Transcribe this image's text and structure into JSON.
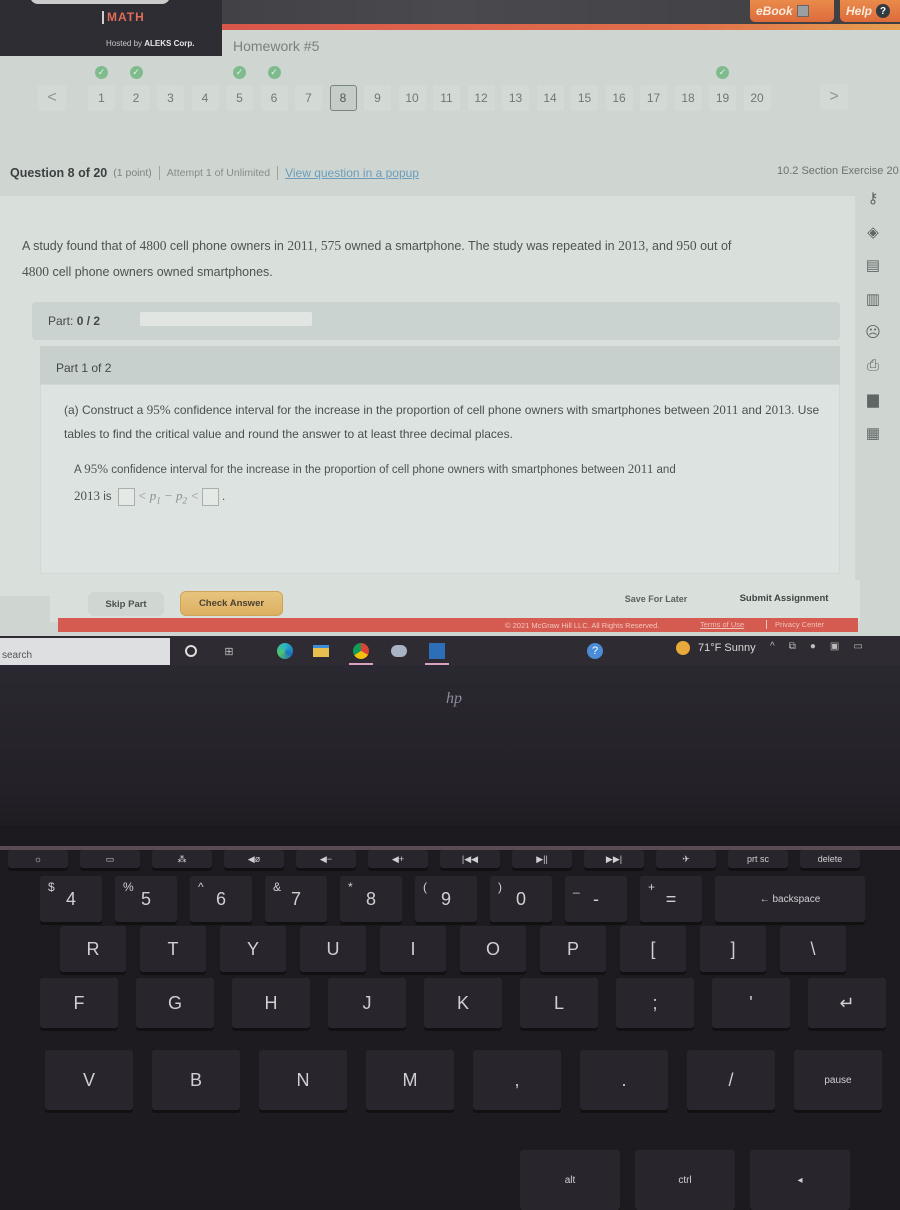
{
  "header": {
    "logo_product": "MATH",
    "logo_hosted_prefix": "Hosted by",
    "logo_hosted_name": "ALEKS Corp.",
    "assignment_title": "Homework #5",
    "ebook_label": "eBook",
    "help_label": "Help",
    "help_icon": "?"
  },
  "question_nav": {
    "prev_icon": "<",
    "next_icon": ">",
    "current": 8,
    "questions": [
      {
        "num": "1",
        "completed": true
      },
      {
        "num": "2",
        "completed": true
      },
      {
        "num": "3",
        "completed": false
      },
      {
        "num": "4",
        "completed": false
      },
      {
        "num": "5",
        "completed": true
      },
      {
        "num": "6",
        "completed": true
      },
      {
        "num": "7",
        "completed": false
      },
      {
        "num": "8",
        "completed": false
      },
      {
        "num": "9",
        "completed": false
      },
      {
        "num": "10",
        "completed": false
      },
      {
        "num": "11",
        "completed": false
      },
      {
        "num": "12",
        "completed": false
      },
      {
        "num": "13",
        "completed": false
      },
      {
        "num": "14",
        "completed": false
      },
      {
        "num": "15",
        "completed": false
      },
      {
        "num": "16",
        "completed": false
      },
      {
        "num": "17",
        "completed": false
      },
      {
        "num": "18",
        "completed": false
      },
      {
        "num": "19",
        "completed": true
      },
      {
        "num": "20",
        "completed": false
      }
    ],
    "check_icon": "✓"
  },
  "question_header": {
    "title": "Question 8 of 20",
    "points": "(1 point)",
    "attempt": "Attempt 1 of Unlimited",
    "popup_link": "View question in a popup",
    "section": "10.2 Section Exercise 20"
  },
  "problem": {
    "t1": "A study found that of ",
    "n1": "4800",
    "t2": " cell phone owners in ",
    "n2": "2011",
    "t3": ", ",
    "n3": "575",
    "t4": " owned a smartphone. The study was repeated in ",
    "n4": "2013",
    "t5": ", and ",
    "n5": "950",
    "t6": " out of ",
    "n6": "4800",
    "t7": " cell phone owners owned smartphones."
  },
  "part": {
    "label": "Part:",
    "progress": "0 / 2",
    "progress_fraction": 0,
    "current_label": "Part 1 of 2"
  },
  "instruction": {
    "t1": "(a) Construct a ",
    "n1": "95%",
    "t2": " confidence interval for the increase in the proportion of cell phone owners with smartphones between ",
    "n2": "2011",
    "t3": " and ",
    "n3": "2013",
    "t4": ". Use tables to find the critical value and round the answer to at least three decimal places."
  },
  "answer": {
    "t1": "A ",
    "n1": "95%",
    "t2": " confidence interval for the increase in the proportion of cell phone owners with smartphones between ",
    "n2": "2011",
    "t3": " and ",
    "n3": "2013",
    "t4": " is",
    "lower_value": "",
    "upper_value": "",
    "ineq_lt1": "<",
    "ineq_p1": "p",
    "ineq_sub1": "1",
    "ineq_minus": "−",
    "ineq_p2": "p",
    "ineq_sub2": "2",
    "ineq_lt2": "<",
    "period": "."
  },
  "tools": [
    {
      "name": "key-icon",
      "glyph": "⚷"
    },
    {
      "name": "tag-icon",
      "glyph": "◈"
    },
    {
      "name": "notes-icon",
      "glyph": "▤"
    },
    {
      "name": "ebook-icon",
      "glyph": "▥"
    },
    {
      "name": "ask-help-icon",
      "glyph": "☹"
    },
    {
      "name": "print-icon",
      "glyph": "⎙"
    },
    {
      "name": "chart-icon",
      "glyph": "▆"
    },
    {
      "name": "calculator-icon",
      "glyph": "▦"
    }
  ],
  "footer": {
    "skip_label": "Skip Part",
    "check_label": "Check Answer",
    "save_label": "Save For Later",
    "submit_label": "Submit Assignment",
    "copyright": "© 2021 McGraw Hill LLC. All Rights Reserved.",
    "terms": "Terms of Use",
    "privacy": "Privacy Center"
  },
  "taskbar": {
    "search_placeholder": "search",
    "task_view_glyph": "⊞",
    "help_glyph": "?",
    "weather": "71°F  Sunny",
    "tray_up": "^",
    "tray_items": [
      "⧉",
      "●",
      "▣",
      "▭"
    ]
  },
  "keyboard": {
    "brand": "hp",
    "fn_row": [
      "☼",
      "▭",
      "⁂",
      "◀ø",
      "◀−",
      "◀+",
      "|◀◀",
      "▶||",
      "▶▶|",
      "✈",
      "prt sc",
      "delete"
    ],
    "num_row": [
      {
        "main": "4",
        "sym": "$"
      },
      {
        "main": "5",
        "sym": "%"
      },
      {
        "main": "6",
        "sym": "^"
      },
      {
        "main": "7",
        "sym": "&"
      },
      {
        "main": "8",
        "sym": "*"
      },
      {
        "main": "9",
        "sym": "("
      },
      {
        "main": "0",
        "sym": ")"
      },
      {
        "main": "-",
        "sym": "_"
      },
      {
        "main": "=",
        "sym": "+"
      },
      {
        "main": "← backspace",
        "sym": ""
      }
    ],
    "top_row": [
      "R",
      "T",
      "Y",
      "U",
      "I",
      "O",
      "P",
      "[",
      "]",
      "\\"
    ],
    "home_row": [
      "F",
      "G",
      "H",
      "J",
      "K",
      "L",
      ";",
      "'",
      "↵"
    ],
    "bottom_row": [
      "V",
      "B",
      "N",
      "M",
      ",",
      ".",
      "/",
      "pause"
    ],
    "space_row": [
      "alt",
      "ctrl",
      "◂"
    ]
  },
  "colors": {
    "brand_red": "#d55a4f",
    "check_green": "#7fbb8d",
    "check_answer_gold": "#dcb062",
    "link_blue": "#6a9cbb"
  }
}
